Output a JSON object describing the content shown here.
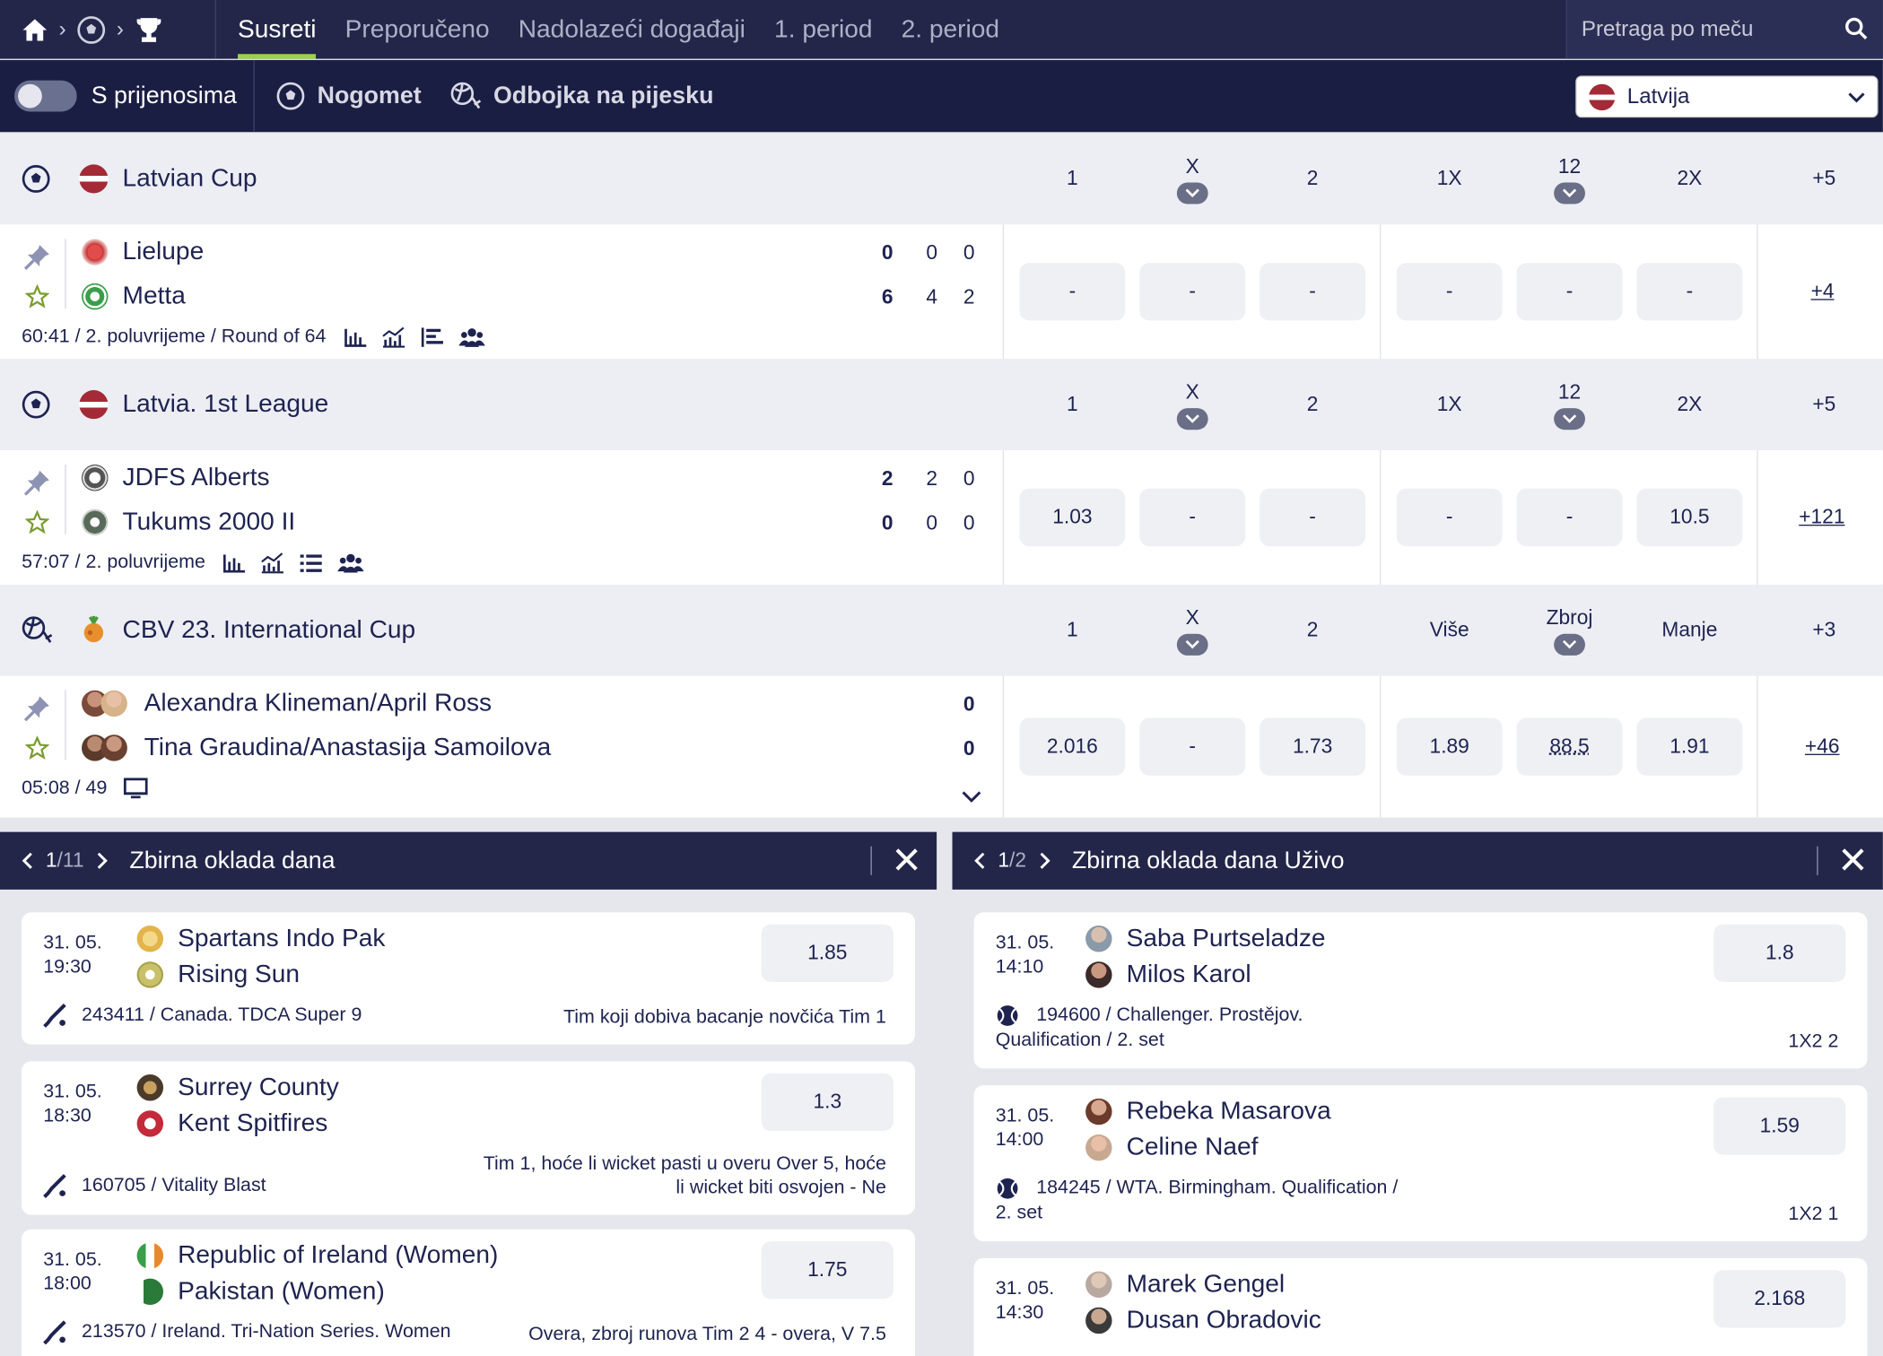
{
  "tabs": [
    "Susreti",
    "Preporučeno",
    "Nadolazeći događaji",
    "1. period",
    "2. period"
  ],
  "search_placeholder": "Pretraga po meču",
  "filters": {
    "toggle_label": "S prijenosima",
    "sport1": "Nogomet",
    "sport2": "Odbojka na pijesku",
    "country": "Latvija"
  },
  "leagues": [
    {
      "name": "Latvian Cup",
      "cols": [
        "1",
        "X",
        "2",
        "1X",
        "12",
        "2X",
        "+5"
      ],
      "home": "Lielupe",
      "away": "Metta",
      "home_scores": [
        "0",
        "0",
        "0"
      ],
      "away_scores": [
        "6",
        "4",
        "2"
      ],
      "meta": "60:41 / 2. poluvrijeme / Round of 64",
      "odds": [
        "-",
        "-",
        "-",
        "-",
        "-",
        "-"
      ],
      "more": "+4"
    },
    {
      "name": "Latvia. 1st League",
      "cols": [
        "1",
        "X",
        "2",
        "1X",
        "12",
        "2X",
        "+5"
      ],
      "home": "JDFS Alberts",
      "away": "Tukums 2000 II",
      "home_scores": [
        "2",
        "2",
        "0"
      ],
      "away_scores": [
        "0",
        "0",
        "0"
      ],
      "meta": "57:07 / 2. poluvrijeme",
      "odds": [
        "1.03",
        "-",
        "-",
        "-",
        "-",
        "10.5"
      ],
      "more": "+121"
    },
    {
      "name": "CBV 23. International Cup",
      "cols": [
        "1",
        "X",
        "2",
        "Više",
        "Zbroj",
        "Manje",
        "+3"
      ],
      "home": "Alexandra Klineman/April Ross",
      "away": "Tina Graudina/Anastasija Samoilova",
      "home_scores": [
        "0"
      ],
      "away_scores": [
        "0"
      ],
      "meta": "05:08 / 49",
      "odds": [
        "2.016",
        "-",
        "1.73",
        "1.89",
        "88.5",
        "1.91"
      ],
      "more": "+46"
    }
  ],
  "panel_left": {
    "page": "1",
    "total": "/11",
    "title": "Zbirna oklada dana",
    "cards": [
      {
        "date": "31. 05.",
        "time": "19:30",
        "home": "Spartans Indo Pak",
        "away": "Rising Sun",
        "odd": "1.85",
        "info": "243411 / Canada. TDCA Super 9",
        "bet": "Tim koji dobiva bacanje novčića Tim 1"
      },
      {
        "date": "31. 05.",
        "time": "18:30",
        "home": "Surrey County",
        "away": "Kent Spitfires",
        "odd": "1.3",
        "info": "160705 / Vitality Blast",
        "bet1": "Tim 1, hoće li wicket pasti u overu Over 5, hoće",
        "bet2": "li wicket biti osvojen - Ne"
      },
      {
        "date": "31. 05.",
        "time": "18:00",
        "home": "Republic of Ireland (Women)",
        "away": "Pakistan (Women)",
        "odd": "1.75",
        "info": "213570 / Ireland. Tri-Nation Series. Women",
        "bet": "Overa, zbroj runova Tim 2 4 - overa, V 7.5"
      }
    ]
  },
  "panel_right": {
    "page": "1",
    "total": "/2",
    "title": "Zbirna oklada dana Uživo",
    "cards": [
      {
        "date": "31. 05.",
        "time": "14:10",
        "home": "Saba Purtseladze",
        "away": "Milos Karol",
        "odd": "1.8",
        "info1": "194600 / Challenger. Prostějov.",
        "info2": "Qualification / 2. set",
        "bet": "1X2 2"
      },
      {
        "date": "31. 05.",
        "time": "14:00",
        "home": "Rebeka Masarova",
        "away": "Celine Naef",
        "odd": "1.59",
        "info1": "184245 / WTA. Birmingham. Qualification /",
        "info2": "2. set",
        "bet": "1X2 1"
      },
      {
        "date": "31. 05.",
        "time": "14:30",
        "home": "Marek Gengel",
        "away": "Dusan Obradovic",
        "odd": "2.168"
      }
    ]
  }
}
